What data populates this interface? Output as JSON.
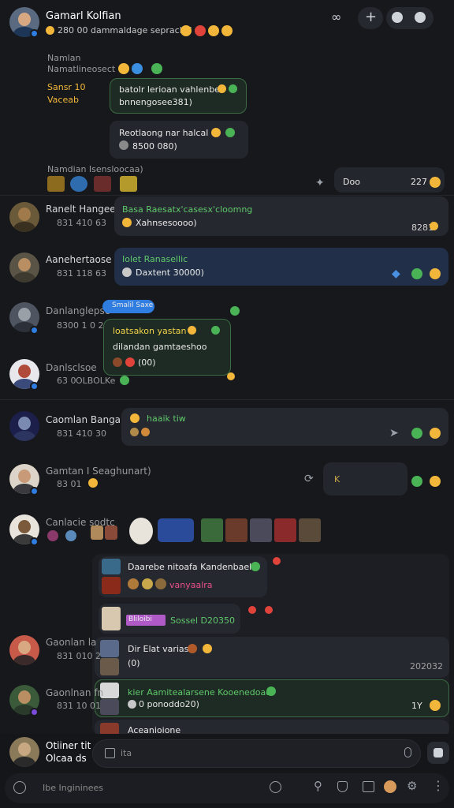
{
  "header": {
    "title": "Gamarl Kolfian",
    "subtitle": "280 00 dammaldage sepracks!",
    "icons": [
      "link-icon",
      "plus-icon",
      "chat-icon",
      "smile-icon"
    ]
  },
  "top_block": {
    "label1": "Namlan",
    "label2": "Namatlineosect",
    "side1": "Sansr 10",
    "side2": "Vaceab",
    "bubble1_line1": "batolr lerioan vahlenber",
    "bubble1_line2": "bnnengosee381)",
    "bubble2_line1": "Reotlaong nar halcal",
    "bubble2_line2": "8500 080)",
    "caption": "Namdian Isensloocaa)",
    "right_bubble_text": "Doo",
    "right_bubble_count": "227"
  },
  "messages": [
    {
      "name": "Ranelt Hangee",
      "meta": "831 410 63",
      "line1": "Basa  Raesatx'casesx'cloomng",
      "line2": "Xahnsesoooo)",
      "stamp": "8281"
    },
    {
      "name": "Aanehertaose",
      "meta": "831 118 63",
      "line1": "Iolet Ranasellic",
      "line2": "Daxtent 30000)"
    },
    {
      "name": "Danlanglepsc",
      "meta": "8300 1 0 23",
      "tag": "Smalil Saxe"
    },
    {
      "name": "Danlsclsoe",
      "meta": "63 0",
      "meta2": "OLBOLKe",
      "line1": "loatsakon yastan",
      "line2": "dilandan gamtaeshoo",
      "line3": "(00)"
    },
    {
      "name": "Caomlan Banga",
      "meta": "831 410 30",
      "line1": "haaik tiw"
    },
    {
      "name": "Gamtan I Seaghunart)",
      "meta": "83 01",
      "right": "K"
    },
    {
      "name": "Canlacie sodtc",
      "meta": ""
    },
    {
      "name": "Gaonlan la",
      "meta": "831 010 2"
    },
    {
      "name": "Gaonlnan fn",
      "meta": "831 10 01"
    }
  ],
  "thread": {
    "bubble_a": "Daarebe nitoafa Kandenbaek",
    "bubble_a2": "vanyaalra",
    "bubble_b": "Sossel D20350",
    "bubble_b_tag": "Bliloibi",
    "bubble_c": "Dir Elat varias",
    "bubble_c2": "(0)",
    "bubble_c_count": "202032",
    "bubble_d": "kier  Aamitealarsene Kooenedoao",
    "bubble_d2": "0 ponoddo20)",
    "bubble_d_count": "1Y",
    "bubble_e": "Aceanioione"
  },
  "composer": {
    "user_line1": "Otiiner tit",
    "user_line2": "Olcaa ds",
    "input_placeholder": "ita",
    "search_placeholder": "Ibe Ingininees"
  },
  "colors": {
    "background": "#17181c",
    "bubble": "#262830",
    "bubble_blue": "#213048",
    "accent_blue": "#2f7de1",
    "accent_green": "#49b356",
    "accent_yellow": "#f2b73a"
  }
}
